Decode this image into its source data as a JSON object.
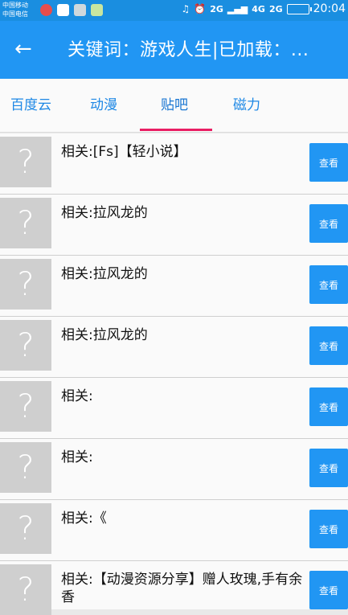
{
  "status_bar": {
    "carrier1": "中国移动",
    "carrier2": "中国电信",
    "network1": "2G",
    "network2": "4G",
    "network3": "2G",
    "time": "20:04",
    "icons": [
      "weibo-icon",
      "notification-icon",
      "image-icon",
      "app-icon",
      "headphones-icon",
      "alarm-icon",
      "signal-icon",
      "battery-icon"
    ]
  },
  "header": {
    "back_icon": "arrow-left-icon",
    "title": "关键词：游戏人生|已加载：..."
  },
  "tabs": [
    "百度云",
    "动漫",
    "贴吧",
    "磁力"
  ],
  "active_tab": 2,
  "list": {
    "button_label": "查看",
    "placeholder_glyph": "?",
    "items": [
      "相关:[Fs]【轻小说】",
      "相关:拉风龙的",
      "相关:拉风龙的",
      "相关:拉风龙的",
      "相关:",
      "相关:",
      "相关:《",
      "相关:【动漫资源分享】赠人玫瑰,手有余香"
    ]
  },
  "colors": {
    "primary": "#2196f3",
    "status_bar": "#1a8ee0",
    "indicator": "#e91e63",
    "placeholder": "#cfcfcf"
  }
}
